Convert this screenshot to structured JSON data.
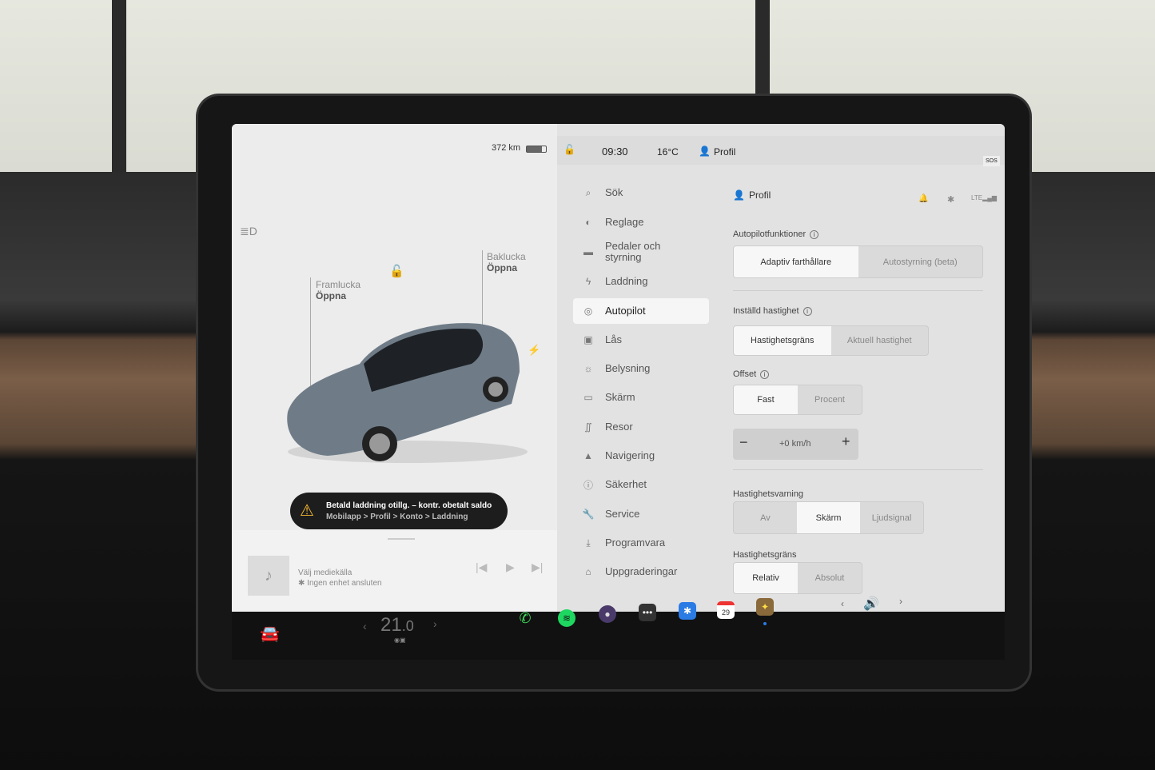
{
  "status": {
    "range": "372 km",
    "time": "09:30",
    "temp": "16°C",
    "profile": "Profil",
    "sos": "SOS"
  },
  "car": {
    "front_trunk_label": "Framlucka",
    "front_trunk_action": "Öppna",
    "rear_trunk_label": "Baklucka",
    "rear_trunk_action": "Öppna"
  },
  "alert": {
    "title": "Betald laddning otillg. – kontr. obetalt saldo",
    "path": "Mobilapp > Profil > Konto > Laddning",
    "accent": "#f5b731"
  },
  "media": {
    "source": "Välj mediekälla",
    "device": "Ingen enhet ansluten"
  },
  "sidebar": {
    "items": [
      {
        "label": "Sök",
        "icon": "search-icon"
      },
      {
        "label": "Reglage",
        "icon": "toggle-icon"
      },
      {
        "label": "Pedaler och styrning",
        "icon": "car-icon"
      },
      {
        "label": "Laddning",
        "icon": "bolt-icon"
      },
      {
        "label": "Autopilot",
        "icon": "steering-wheel-icon",
        "active": true
      },
      {
        "label": "Lås",
        "icon": "lock-icon"
      },
      {
        "label": "Belysning",
        "icon": "sun-icon"
      },
      {
        "label": "Skärm",
        "icon": "display-icon"
      },
      {
        "label": "Resor",
        "icon": "trips-icon"
      },
      {
        "label": "Navigering",
        "icon": "navigation-icon"
      },
      {
        "label": "Säkerhet",
        "icon": "safety-icon"
      },
      {
        "label": "Service",
        "icon": "wrench-icon"
      },
      {
        "label": "Programvara",
        "icon": "download-icon"
      },
      {
        "label": "Uppgraderingar",
        "icon": "bag-icon"
      }
    ]
  },
  "settings": {
    "header": "Profil",
    "autopilot_features": {
      "label": "Autopilotfunktioner",
      "options": [
        "Adaptiv farthållare",
        "Autostyrning (beta)"
      ],
      "selected": 0
    },
    "set_speed": {
      "label": "Inställd hastighet",
      "options": [
        "Hastighetsgräns",
        "Aktuell hastighet"
      ],
      "selected": 0
    },
    "offset": {
      "label": "Offset",
      "options": [
        "Fast",
        "Procent"
      ],
      "selected": 0,
      "value": "+0 km/h"
    },
    "speed_warning": {
      "label": "Hastighetsvarning",
      "options": [
        "Av",
        "Skärm",
        "Ljudsignal"
      ],
      "selected": 1
    },
    "speed_limit": {
      "label": "Hastighetsgräns",
      "options": [
        "Relativ",
        "Absolut"
      ],
      "selected": 0
    }
  },
  "taskbar": {
    "temp_int": "21",
    "temp_dec": ".0",
    "calendar_day": "29"
  }
}
